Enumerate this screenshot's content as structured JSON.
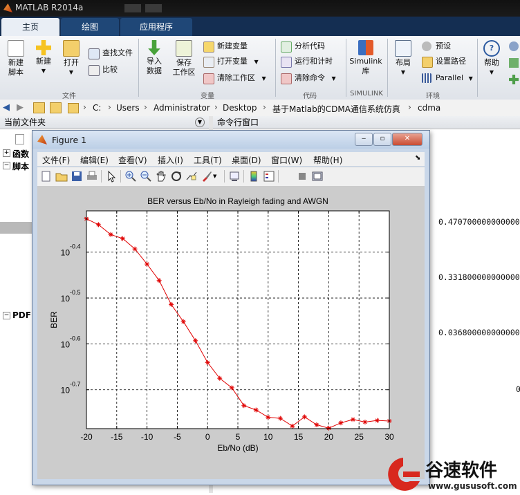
{
  "app": {
    "title": "MATLAB R2014a"
  },
  "tabs": [
    {
      "label": "主页"
    },
    {
      "label": "绘图"
    },
    {
      "label": "应用程序"
    }
  ],
  "ribbon": {
    "new_script": "新建\n脚本",
    "new": "新建",
    "open": "打开",
    "find_files": "查找文件",
    "compare": "比较",
    "import_data": "导入\n数据",
    "save_workspace": "保存\n工作区",
    "new_variable": "新建变量",
    "open_variable": "打开变量",
    "clear_workspace": "清除工作区",
    "analyze_code": "分析代码",
    "run_and_time": "运行和计时",
    "clear_commands": "清除命令",
    "simulink": "Simulink\n库",
    "layout": "布局",
    "preferences": "预设",
    "set_path": "设置路径",
    "parallel": "Parallel",
    "help": "帮助",
    "sections": {
      "file": "文件",
      "variable": "变量",
      "code": "代码",
      "simulink": "SIMULINK",
      "environment": "环境"
    }
  },
  "address_bar": {
    "crumbs": [
      "C:",
      "Users",
      "Administrator",
      "Desktop",
      "基于Matlab的CDMA通信系统仿真",
      "cdma"
    ]
  },
  "left_pane": {
    "title": "当前文件夹",
    "items": [
      "函数",
      "脚本",
      "PDF"
    ]
  },
  "right_pane": {
    "title": "命令行窗口",
    "values": [
      "0.470700000000000",
      "0.331800000000000",
      "0.036800000000000"
    ],
    "partial": "0"
  },
  "figure": {
    "title": "Figure 1",
    "menus": [
      "文件(F)",
      "编辑(E)",
      "查看(V)",
      "插入(I)",
      "工具(T)",
      "桌面(D)",
      "窗口(W)",
      "帮助(H)"
    ],
    "colors": {
      "line": "#e00000",
      "axes_bg": "#ffffff",
      "figure_bg": "#cccccc"
    }
  },
  "chart_data": {
    "type": "line",
    "title": "BER versus Eb/No in Rayleigh fading and AWGN",
    "xlabel": "Eb/No (dB)",
    "ylabel": "BER",
    "yscale": "log",
    "xlim": [
      -20,
      30
    ],
    "xticks": [
      -20,
      -15,
      -10,
      -5,
      0,
      5,
      10,
      15,
      20,
      25,
      30
    ],
    "ylim": [
      0.1641,
      0.4898
    ],
    "yticks": [
      {
        "value": 0.1995,
        "base": "10",
        "exp": "-0.7"
      },
      {
        "value": 0.2512,
        "base": "10",
        "exp": "-0.6"
      },
      {
        "value": 0.3162,
        "base": "10",
        "exp": "-0.5"
      },
      {
        "value": 0.3981,
        "base": "10",
        "exp": "-0.4"
      }
    ],
    "grid": true,
    "marker": "*",
    "x": [
      -20,
      -18,
      -16,
      -14,
      -12,
      -10,
      -8,
      -6,
      -4,
      -2,
      0,
      2,
      4,
      6,
      8,
      10,
      12,
      14,
      16,
      18,
      20,
      22,
      24,
      26,
      28,
      30
    ],
    "y": [
      0.4707,
      0.457,
      0.435,
      0.4262,
      0.4045,
      0.3749,
      0.3453,
      0.3061,
      0.2809,
      0.2552,
      0.2287,
      0.2113,
      0.2015,
      0.1842,
      0.1802,
      0.1737,
      0.1728,
      0.1662,
      0.1741,
      0.1673,
      0.1645,
      0.1689,
      0.1718,
      0.1696,
      0.171,
      0.1705
    ]
  },
  "watermark": {
    "brand": "谷速软件",
    "url": "www.gususoft.com"
  }
}
